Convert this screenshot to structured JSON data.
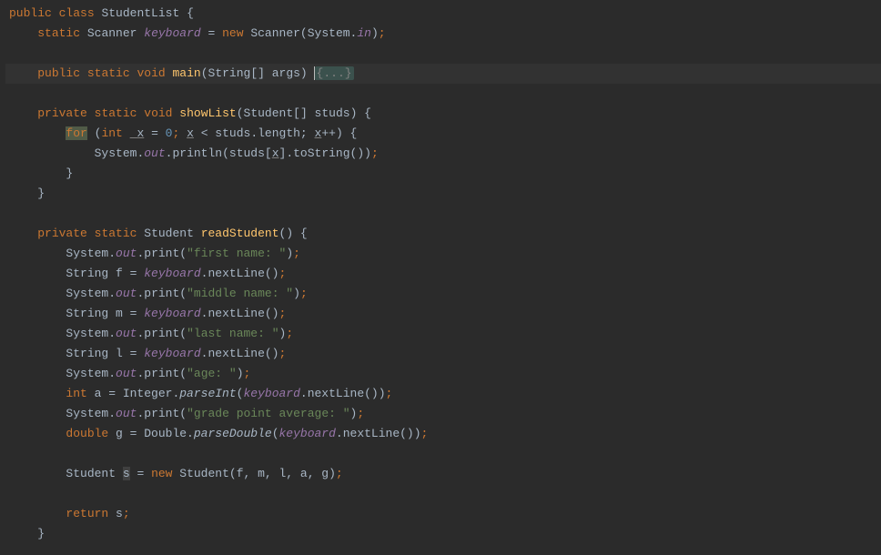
{
  "code": {
    "l1": {
      "kw1": "public",
      "kw2": "class",
      "cls": "StudentList",
      "brace": " {"
    },
    "l2": {
      "kw1": "static",
      "type": "Scanner",
      "field": "keyboard",
      "eq": " = ",
      "kw2": "new",
      "ctor": "Scanner",
      "paren1": "(",
      "sys": "System",
      "dot": ".",
      "in": "in",
      "paren2": ")",
      "semi": ";"
    },
    "l3": {
      "kw1": "public",
      "kw2": "static",
      "kw3": "void",
      "name": "main",
      "sig": "(String[] args) ",
      "fold": "{...}"
    },
    "l4": {
      "kw1": "private",
      "kw2": "static",
      "kw3": "void",
      "name": "showList",
      "paren1": "(",
      "ptype": "Student[]",
      "pname": " studs",
      "paren2": ")",
      "brace": " {"
    },
    "l5": {
      "kw1": "for",
      "paren1": " (",
      "kw2": "int",
      "var": " x",
      "eq": " = ",
      "num": "0",
      "semi1": "; ",
      "var2": "x",
      "cmp": " < studs.length; ",
      "var3": "x",
      "inc": "++) {"
    },
    "l6": {
      "sys": "System",
      "dot1": ".",
      "out": "out",
      "dot2": ".",
      "call": "println",
      "paren1": "(",
      "studs": "studs[",
      "x": "x",
      "close": "].toString())",
      "semi": ";"
    },
    "l7": {
      "brace": "}"
    },
    "l8": {
      "brace": "}"
    },
    "l9": {
      "kw1": "private",
      "kw2": "static",
      "type": "Student",
      "name": "readStudent",
      "sig": "() {"
    },
    "l10": {
      "sys": "System",
      "dot1": ".",
      "out": "out",
      "dot2": ".",
      "call": "print",
      "paren1": "(",
      "str": "\"first name: \"",
      "paren2": ")",
      "semi": ";"
    },
    "l11": {
      "type": "String",
      "var": " f = ",
      "kb": "keyboard",
      "call": ".nextLine()",
      "semi": ";"
    },
    "l12": {
      "sys": "System",
      "dot1": ".",
      "out": "out",
      "dot2": ".",
      "call": "print",
      "paren1": "(",
      "str": "\"middle name: \"",
      "paren2": ")",
      "semi": ";"
    },
    "l13": {
      "type": "String",
      "var": " m = ",
      "kb": "keyboard",
      "call": ".nextLine()",
      "semi": ";"
    },
    "l14": {
      "sys": "System",
      "dot1": ".",
      "out": "out",
      "dot2": ".",
      "call": "print",
      "paren1": "(",
      "str": "\"last name: \"",
      "paren2": ")",
      "semi": ";"
    },
    "l15": {
      "type": "String",
      "var": " l = ",
      "kb": "keyboard",
      "call": ".nextLine()",
      "semi": ";"
    },
    "l16": {
      "sys": "System",
      "dot1": ".",
      "out": "out",
      "dot2": ".",
      "call": "print",
      "paren1": "(",
      "str": "\"age: \"",
      "paren2": ")",
      "semi": ";"
    },
    "l17": {
      "kw": "int",
      "var": " a = Integer.",
      "pcall": "parseInt",
      "paren1": "(",
      "kb": "keyboard",
      "call": ".nextLine())",
      "semi": ";"
    },
    "l18": {
      "sys": "System",
      "dot1": ".",
      "out": "out",
      "dot2": ".",
      "call": "print",
      "paren1": "(",
      "str": "\"grade point average: \"",
      "paren2": ")",
      "semi": ";"
    },
    "l19": {
      "kw": "double",
      "var": " g = Double.",
      "pcall": "parseDouble",
      "paren1": "(",
      "kb": "keyboard",
      "call": ".nextLine())",
      "semi": ";"
    },
    "l20": {
      "type": "Student ",
      "s": "s",
      "eq": " = ",
      "kw": "new",
      "ctor": " Student(",
      "args": "f, m, l, a, g",
      "paren2": ")",
      "semi": ";"
    },
    "l21": {
      "kw": "return",
      "var": " s",
      "semi": ";"
    },
    "l22": {
      "brace": "}"
    }
  }
}
